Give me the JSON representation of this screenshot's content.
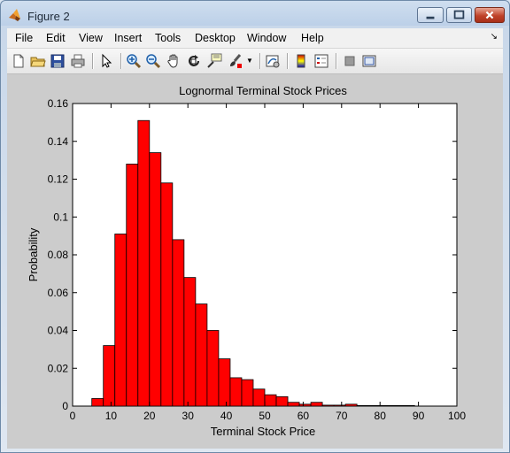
{
  "window": {
    "title": "Figure 2"
  },
  "menu": [
    "File",
    "Edit",
    "View",
    "Insert",
    "Tools",
    "Desktop",
    "Window",
    "Help"
  ],
  "menu_extra_icon": "dock-arrow-icon",
  "toolbar_icons": [
    "new-figure-icon",
    "open-file-icon",
    "save-icon",
    "print-icon",
    "edit-plot-arrow-icon",
    "zoom-in-icon",
    "zoom-out-icon",
    "pan-hand-icon",
    "rotate-3d-icon",
    "data-cursor-icon",
    "brush-icon",
    "link-plot-icon",
    "colorbar-icon",
    "legend-icon",
    "hide-plot-tools-icon",
    "show-plot-tools-icon"
  ],
  "chart_data": {
    "type": "bar",
    "title": "Lognormal Terminal Stock Prices",
    "xlabel": "Terminal Stock Price",
    "ylabel": "Probability",
    "xlim": [
      0,
      100
    ],
    "ylim": [
      0,
      0.16
    ],
    "xticks": [
      "0",
      "10",
      "20",
      "30",
      "40",
      "50",
      "60",
      "70",
      "80",
      "90",
      "100"
    ],
    "yticks": [
      "0",
      "0.02",
      "0.04",
      "0.06",
      "0.08",
      "0.1",
      "0.12",
      "0.14",
      "0.16"
    ],
    "bin_width": 3,
    "bin_start": 5,
    "values": [
      0.004,
      0.032,
      0.091,
      0.128,
      0.151,
      0.134,
      0.118,
      0.088,
      0.068,
      0.054,
      0.04,
      0.025,
      0.015,
      0.014,
      0.009,
      0.006,
      0.005,
      0.002,
      0.001,
      0.002,
      0.0005,
      0.0005,
      0.001,
      0.0003,
      0.0003,
      0.0003,
      0.0003,
      0.0003
    ],
    "bar_color": "#ff0000",
    "grid": false
  }
}
